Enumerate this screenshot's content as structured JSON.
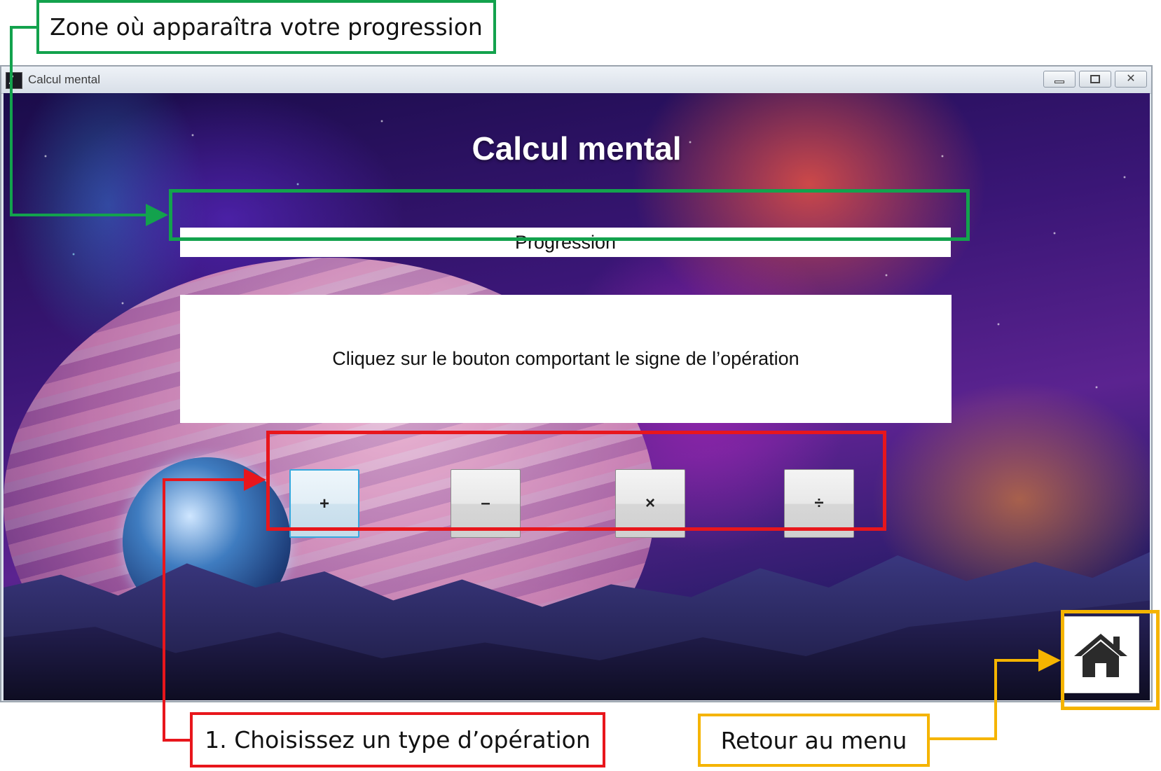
{
  "window": {
    "title": "Calcul mental"
  },
  "app": {
    "title": "Calcul mental",
    "progress_label": "Progression",
    "instruction": "Cliquez sur le bouton comportant le signe de l’opération",
    "operations": [
      {
        "symbol": "+",
        "name": "addition",
        "focused": true
      },
      {
        "symbol": "–",
        "name": "soustraction",
        "focused": false
      },
      {
        "symbol": "×",
        "name": "multiplication",
        "focused": false
      },
      {
        "symbol": "÷",
        "name": "division",
        "focused": false
      }
    ],
    "home_icon": "home-icon"
  },
  "annotations": {
    "progress": "Zone où apparaîtra votre progression",
    "operations": "1. Choisissez un type d’opération",
    "home": "Retour au menu"
  },
  "colors": {
    "annotation_green": "#13a24d",
    "annotation_red": "#e8161c",
    "annotation_yellow": "#f5b400",
    "focus_border": "#37a8dd"
  }
}
